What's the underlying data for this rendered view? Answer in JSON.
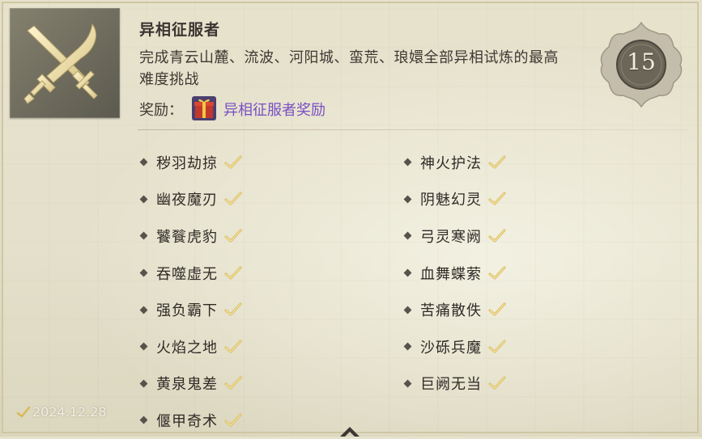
{
  "achievement": {
    "title": "异相征服者",
    "description": "完成青云山麓、流波、河阳城、蛮荒、琅嬛全部异相试炼的最高难度挑战",
    "reward_label": "奖励：",
    "reward_name": "异相征服者奖励",
    "points": "15",
    "date": "2024.12.28",
    "icon": "crossed-swords-icon",
    "reward_icon": "gift-box-icon",
    "reward_color": "#7a4fc4"
  },
  "trials_left": [
    "秽羽劫掠",
    "幽夜魔刃",
    "饕餮虎豹",
    "吞噬虚无",
    "强负霸下",
    "火焰之地",
    "黄泉鬼差",
    "偃甲奇术"
  ],
  "trials_right": [
    "神火护法",
    "阴魅幻灵",
    "弓灵寒阙",
    "血舞蝶萦",
    "苦痛散佚",
    "沙砾兵魔",
    "巨阙无当"
  ]
}
